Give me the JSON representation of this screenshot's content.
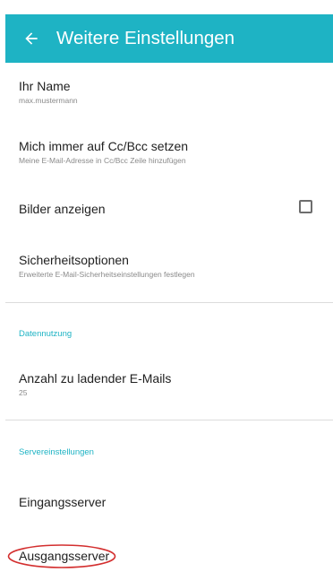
{
  "header": {
    "title": "Weitere Einstellungen",
    "back_icon": "arrow-back-icon"
  },
  "colors": {
    "accent": "#1eb3c4",
    "annotation": "#d32f2f"
  },
  "items": {
    "name": {
      "title": "Ihr Name",
      "subtitle": "max.mustermann"
    },
    "ccbcc": {
      "title": "Mich immer auf Cc/Bcc setzen",
      "subtitle": "Meine E-Mail-Adresse in Cc/Bcc Zeile hinzufügen"
    },
    "images": {
      "title": "Bilder anzeigen",
      "checked": false
    },
    "security": {
      "title": "Sicherheitsoptionen",
      "subtitle": "Erweiterte E-Mail-Sicherheitseinstellungen festlegen"
    },
    "email_count": {
      "title": "Anzahl zu ladender E-Mails",
      "subtitle": "25"
    },
    "incoming": {
      "title": "Eingangsserver"
    },
    "outgoing": {
      "title": "Ausgangsserver"
    }
  },
  "sections": {
    "data_usage": "Datennutzung",
    "server_settings": "Servereinstellungen"
  }
}
